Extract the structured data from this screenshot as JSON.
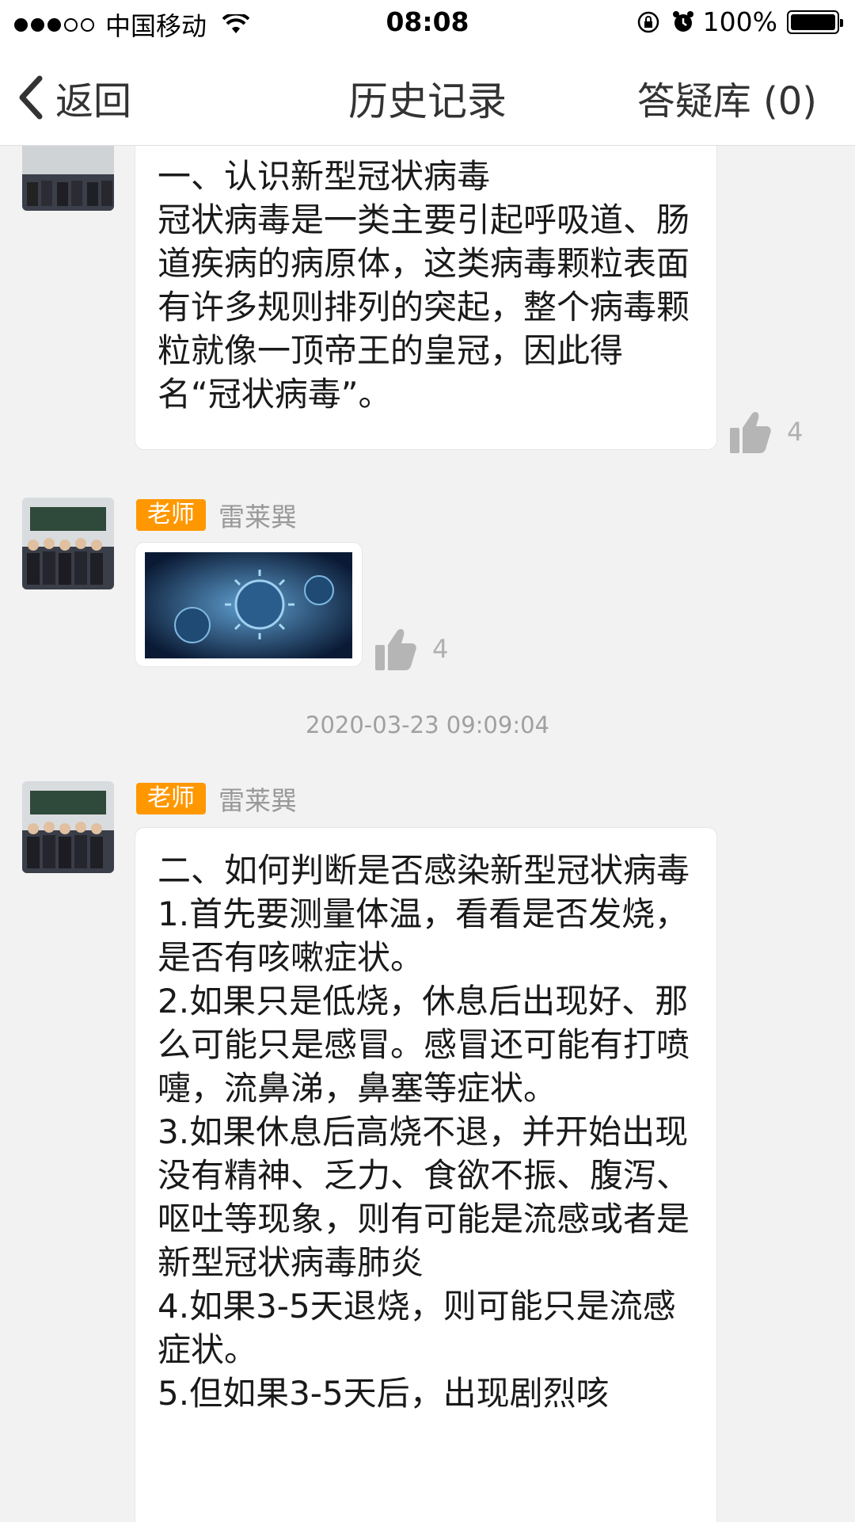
{
  "status_bar": {
    "carrier": "中国移动",
    "time": "08:08",
    "battery": "100%",
    "signal_dots_full": 3,
    "signal_dots_total": 5
  },
  "nav": {
    "back_label": "返回",
    "title": "历史记录",
    "right_label": "答疑库 (0)"
  },
  "messages": [
    {
      "text": "一、认识新型冠状病毒\n冠状病毒是一类主要引起呼吸道、肠道疾病的病原体，这类病毒颗粒表面有许多规则排列的突起，整个病毒颗粒就像一顶帝王的皇冠，因此得名“冠状病毒”。",
      "likes": "4"
    },
    {
      "badge": "老师",
      "sender": "雷莱巽",
      "image": "coronavirus-image",
      "likes": "4"
    },
    {
      "timestamp": "2020-03-23 09:09:04"
    },
    {
      "badge": "老师",
      "sender": "雷莱巽",
      "text": "二、如何判断是否感染新型冠状病毒\n1.首先要测量体温，看看是否发烧，是否有咳嗽症状。\n2.如果只是低烧，休息后出现好、那么可能只是感冒。感冒还可能有打喷嚏，流鼻涕，鼻塞等症状。\n3.如果休息后高烧不退，并开始出现没有精神、乏力、食欲不振、腹泻、呕吐等现象，则有可能是流感或者是新型冠状病毒肺炎\n4.如果3-5天退烧，则可能只是流感症状。\n5.但如果3-5天后，出现剧烈咳"
    }
  ],
  "colors": {
    "badge": "#ff9800",
    "background": "#f2f2f2",
    "bubble": "#ffffff"
  }
}
